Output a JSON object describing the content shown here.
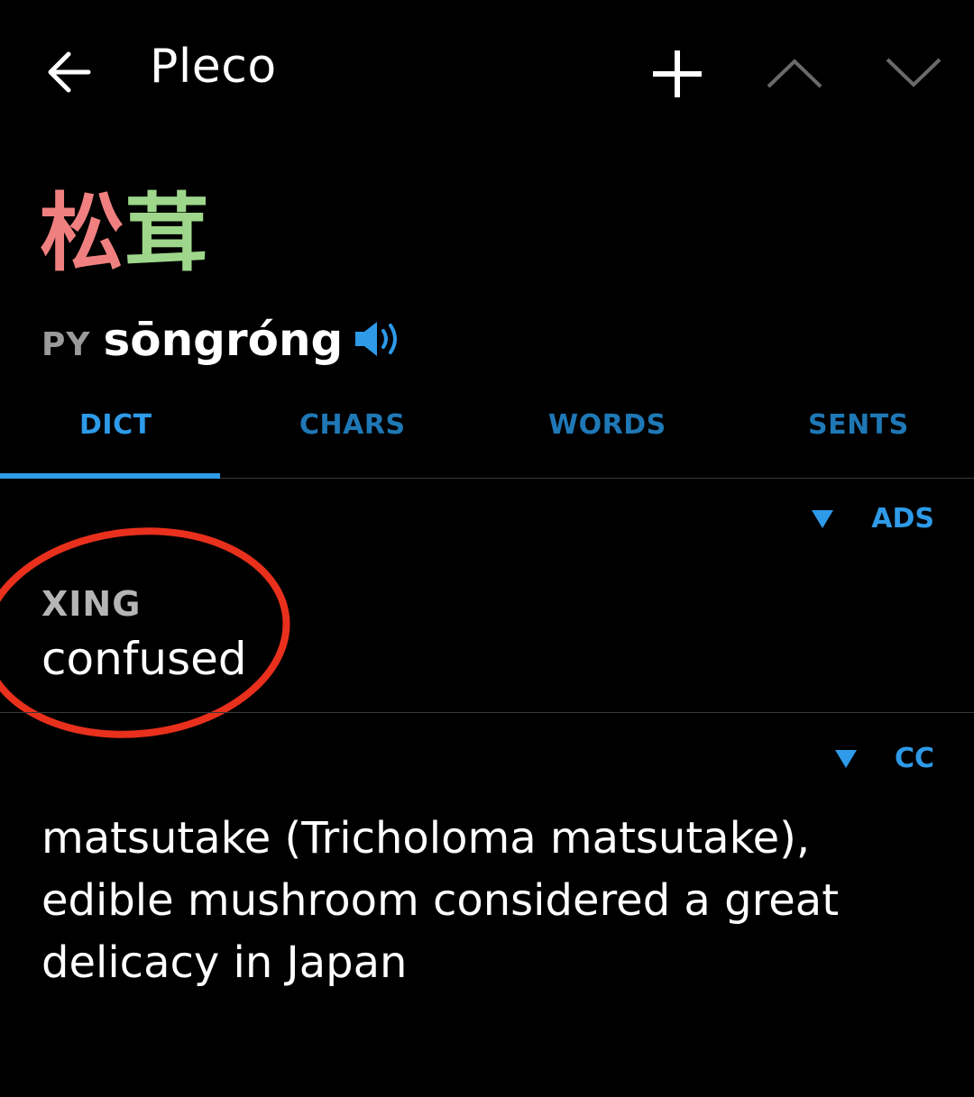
{
  "toolbar": {
    "title": "Pleco",
    "back_icon": "arrow-left-icon",
    "add_icon": "plus-icon",
    "prev_icon": "chevron-up-icon",
    "next_icon": "chevron-down-icon"
  },
  "entry": {
    "headword_chars": [
      {
        "char": "松",
        "color": "#f08080"
      },
      {
        "char": "茸",
        "color": "#9ed78b"
      }
    ],
    "pinyin_tag": "PY",
    "pinyin": "sōngróng",
    "audio_icon": "speaker-icon"
  },
  "tabs": [
    {
      "label": "DICT",
      "active": true
    },
    {
      "label": "CHARS",
      "active": false
    },
    {
      "label": "WORDS",
      "active": false
    },
    {
      "label": "SENTS",
      "active": false
    }
  ],
  "sections": {
    "ads": {
      "source_label": "ADS",
      "field_label": "XING",
      "field_value": "confused"
    },
    "cc": {
      "source_label": "CC",
      "definition": "matsutake (Tricholoma matsutake), edible mushroom considered a great delicacy in Japan"
    }
  },
  "colors": {
    "accent": "#2e9ae8",
    "tab_inactive": "#1f78b6",
    "annotation": "#e8301c",
    "background": "#000000"
  }
}
